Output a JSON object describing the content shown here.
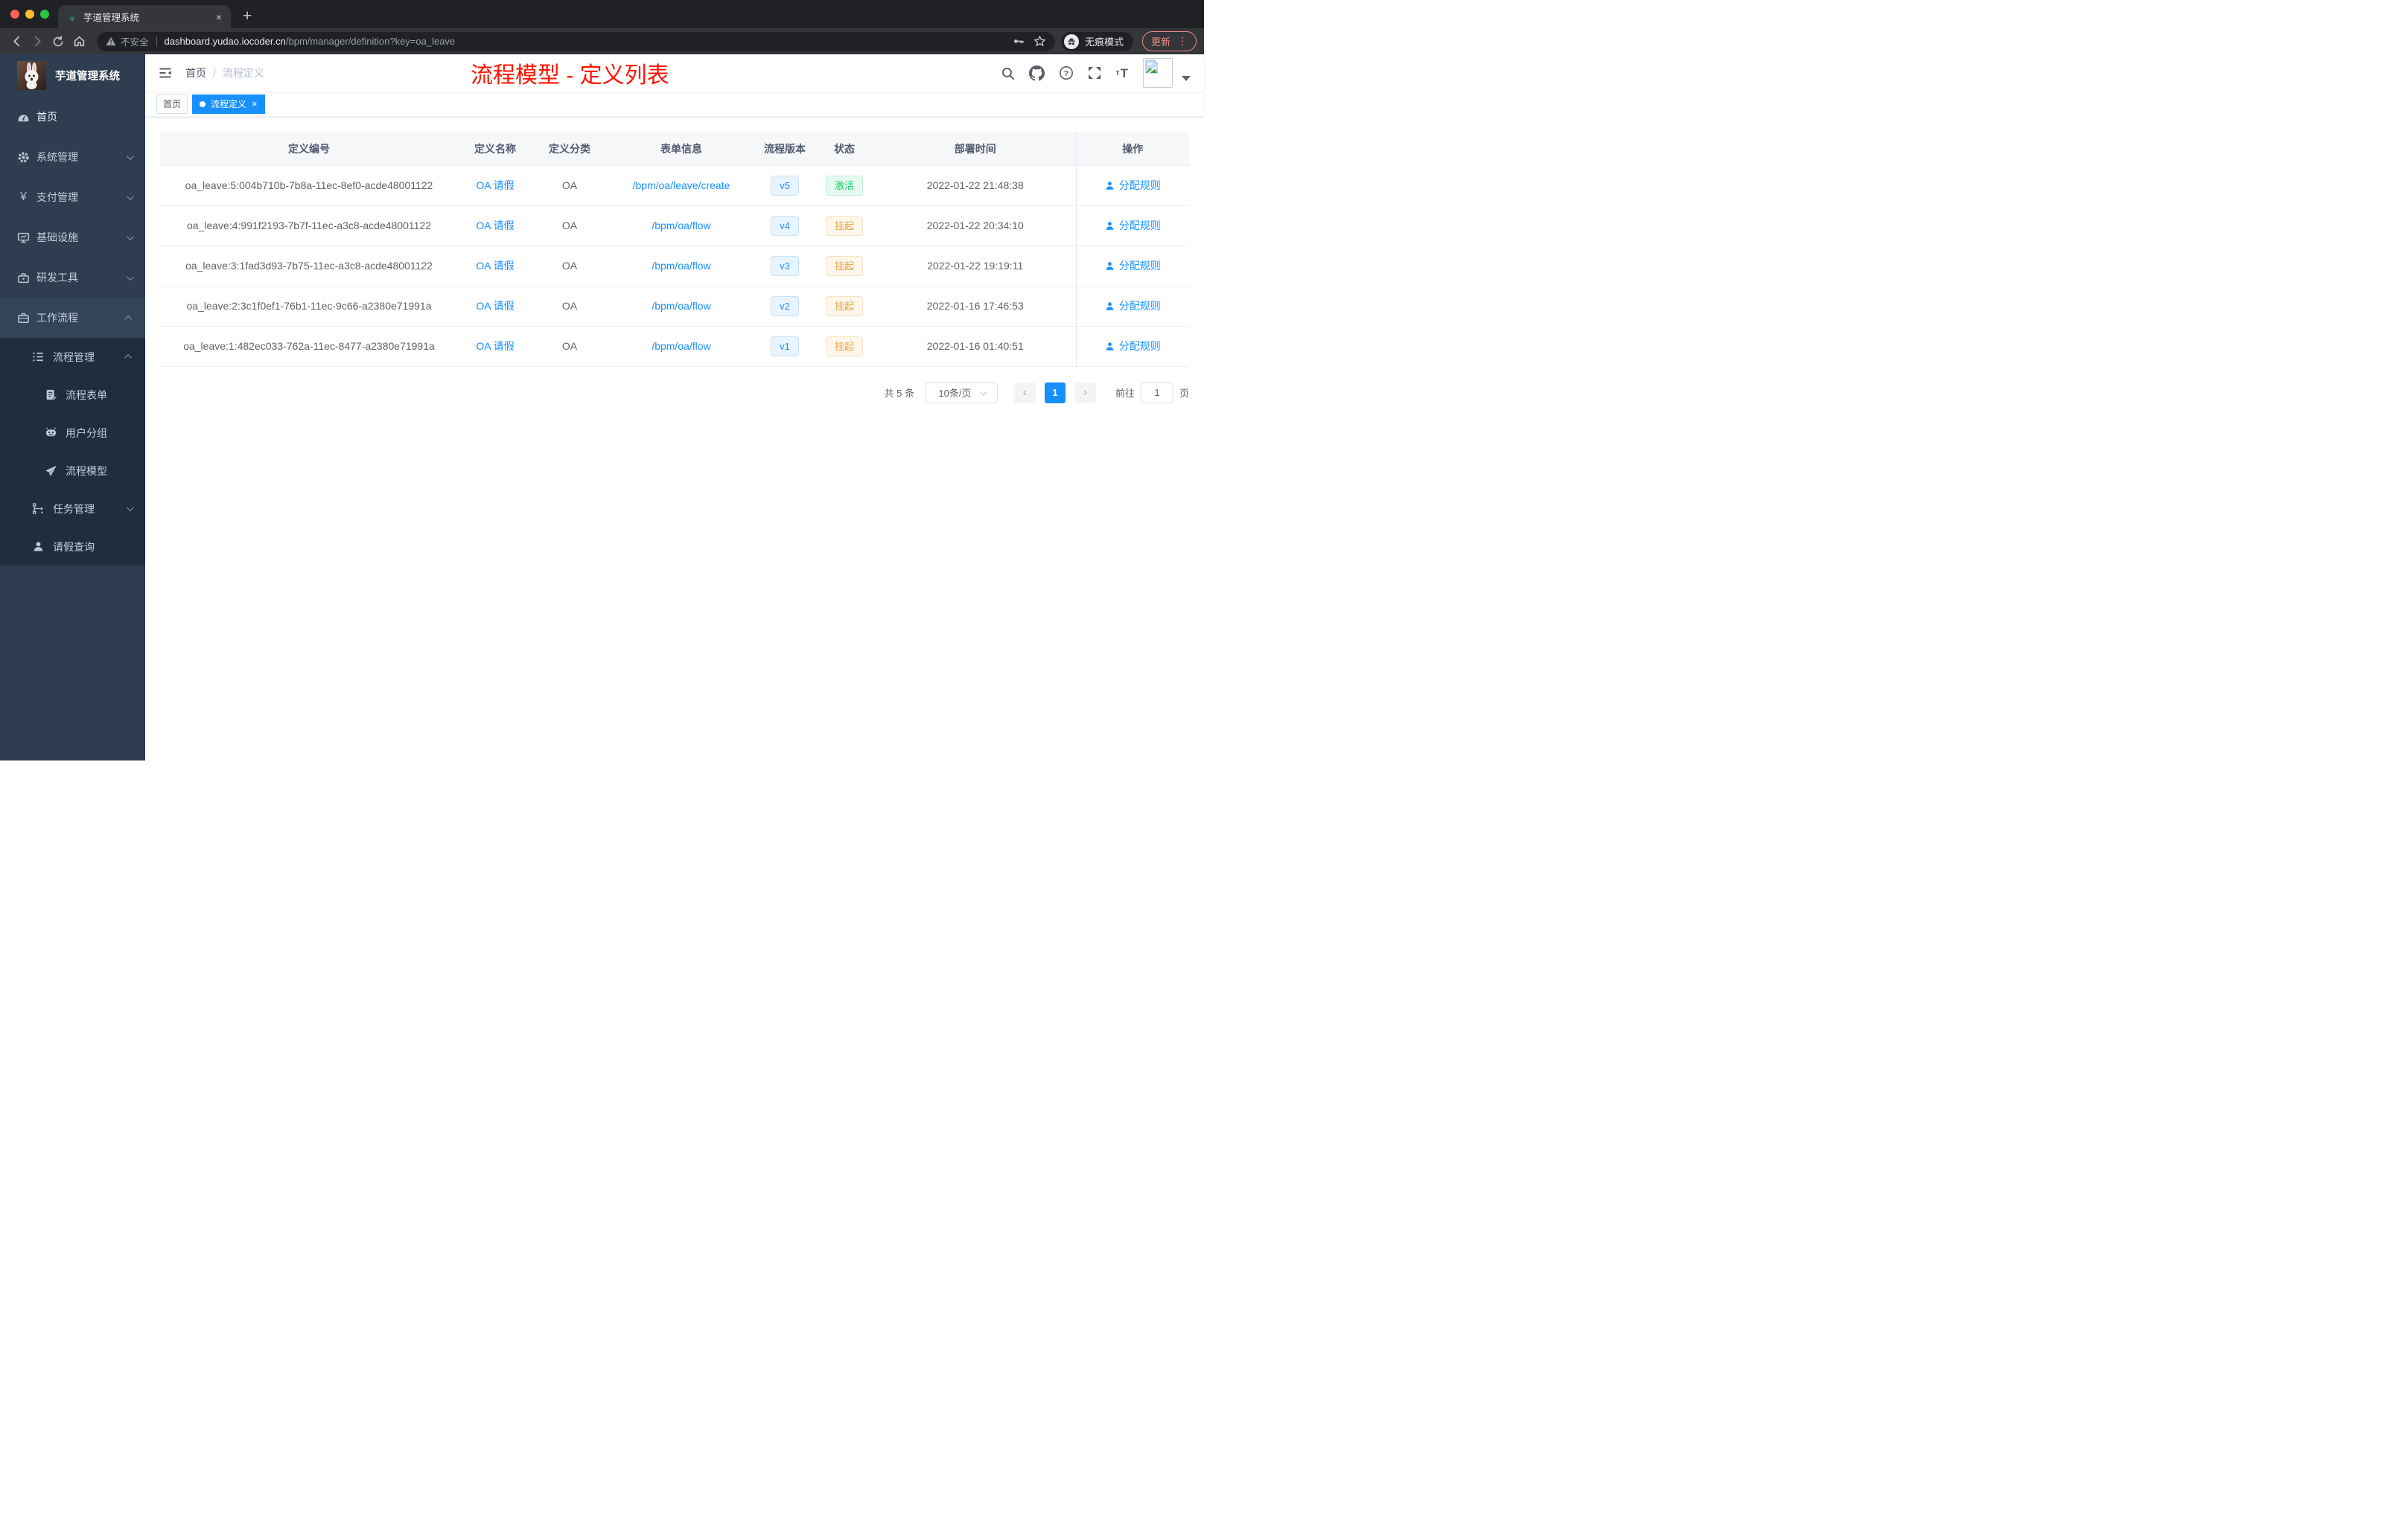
{
  "browser": {
    "tab_title": "芋道管理系统",
    "close_tab_glyph": "×",
    "new_tab_glyph": "+",
    "security_label": "不安全",
    "url_host": "dashboard.yudao.iocoder.cn",
    "url_path": "/bpm/manager/definition?key=oa_leave",
    "incognito_label": "无痕模式",
    "update_label": "更新",
    "more_glyph": "⋮"
  },
  "sidebar": {
    "logo_title": "芋道管理系统",
    "yen_glyph": "¥",
    "items": {
      "home": "首页",
      "system": "系统管理",
      "pay": "支付管理",
      "infra": "基础设施",
      "dev": "研发工具",
      "workflow": "工作流程",
      "process_mgmt": "流程管理",
      "process_form": "流程表单",
      "user_group": "用户分组",
      "process_model": "流程模型",
      "task_mgmt": "任务管理",
      "leave_query": "请假查询"
    }
  },
  "navbar": {
    "breadcrumb_home": "首页",
    "breadcrumb_sep": "/",
    "breadcrumb_current": "流程定义",
    "page_title": "流程模型 - 定义列表",
    "question_glyph": "?",
    "font_small_glyph": "т",
    "font_large_glyph": "T"
  },
  "tags": {
    "home": "首页",
    "active": "流程定义",
    "close_glyph": "×"
  },
  "table": {
    "columns": [
      "定义编号",
      "定义名称",
      "定义分类",
      "表单信息",
      "流程版本",
      "状态",
      "部署时间",
      "操作"
    ],
    "rows": [
      {
        "id": "oa_leave:5:004b710b-7b8a-11ec-8ef0-acde48001122",
        "name": "OA 请假",
        "category": "OA",
        "form": "/bpm/oa/leave/create",
        "version": "v5",
        "status": "激活",
        "status_type": "success",
        "time": "2022-01-22 21:48:38",
        "action": "分配规则"
      },
      {
        "id": "oa_leave:4:991f2193-7b7f-11ec-a3c8-acde48001122",
        "name": "OA 请假",
        "category": "OA",
        "form": "/bpm/oa/flow",
        "version": "v4",
        "status": "挂起",
        "status_type": "warning",
        "time": "2022-01-22 20:34:10",
        "action": "分配规则"
      },
      {
        "id": "oa_leave:3:1fad3d93-7b75-11ec-a3c8-acde48001122",
        "name": "OA 请假",
        "category": "OA",
        "form": "/bpm/oa/flow",
        "version": "v3",
        "status": "挂起",
        "status_type": "warning",
        "time": "2022-01-22 19:19:11",
        "action": "分配规则"
      },
      {
        "id": "oa_leave:2:3c1f0ef1-76b1-11ec-9c66-a2380e71991a",
        "name": "OA 请假",
        "category": "OA",
        "form": "/bpm/oa/flow",
        "version": "v2",
        "status": "挂起",
        "status_type": "warning",
        "time": "2022-01-16 17:46:53",
        "action": "分配规则"
      },
      {
        "id": "oa_leave:1:482ec033-762a-11ec-8477-a2380e71991a",
        "name": "OA 请假",
        "category": "OA",
        "form": "/bpm/oa/flow",
        "version": "v1",
        "status": "挂起",
        "status_type": "warning",
        "time": "2022-01-16 01:40:51",
        "action": "分配规则"
      }
    ]
  },
  "pagination": {
    "total": "共 5 条",
    "page_size": "10条/页",
    "prev_glyph": "‹",
    "next_glyph": "›",
    "page": "1",
    "goto_label": "前往",
    "goto_value": "1",
    "unit": "页"
  },
  "colors": {
    "primary": "#1890ff",
    "title_red": "#ff1200",
    "success": "#13ce66",
    "warning": "#e6a23c",
    "sidebar_bg": "#2e3d4f",
    "submenu_bg": "#1f2d3d"
  }
}
